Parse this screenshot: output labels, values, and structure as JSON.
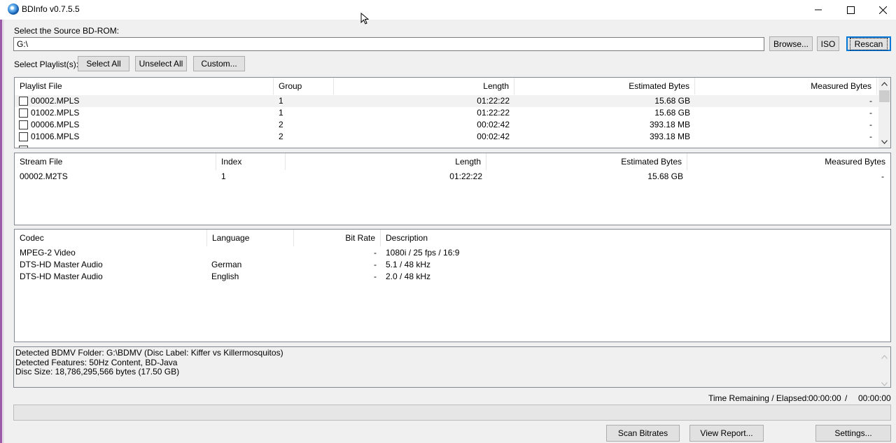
{
  "window": {
    "title": "BDInfo v0.7.5.5",
    "minimize_icon": "minimize-icon",
    "maximize_icon": "maximize-icon",
    "close_icon": "close-icon"
  },
  "source": {
    "label": "Select the Source BD-ROM:",
    "path": "G:\\",
    "browse": "Browse...",
    "iso": "ISO",
    "rescan": "Rescan"
  },
  "playlist_select": {
    "label": "Select Playlist(s):",
    "select_all": "Select All",
    "unselect_all": "Unselect All",
    "custom": "Custom..."
  },
  "playlists": {
    "headers": {
      "file": "Playlist File",
      "group": "Group",
      "length": "Length",
      "est": "Estimated Bytes",
      "meas": "Measured Bytes"
    },
    "rows": [
      {
        "file": "00002.MPLS",
        "group": "1",
        "length": "01:22:22",
        "est": "15.68 GB",
        "meas": "-"
      },
      {
        "file": "01002.MPLS",
        "group": "1",
        "length": "01:22:22",
        "est": "15.68 GB",
        "meas": "-"
      },
      {
        "file": "00006.MPLS",
        "group": "2",
        "length": "00:02:42",
        "est": "393.18 MB",
        "meas": "-"
      },
      {
        "file": "01006.MPLS",
        "group": "2",
        "length": "00:02:42",
        "est": "393.18 MB",
        "meas": "-"
      }
    ]
  },
  "streams": {
    "headers": {
      "file": "Stream File",
      "index": "Index",
      "length": "Length",
      "est": "Estimated Bytes",
      "meas": "Measured Bytes"
    },
    "rows": [
      {
        "file": "00002.M2TS",
        "index": "1",
        "length": "01:22:22",
        "est": "15.68 GB",
        "meas": "-"
      }
    ]
  },
  "codecs": {
    "headers": {
      "codec": "Codec",
      "language": "Language",
      "bitrate": "Bit Rate",
      "desc": "Description"
    },
    "rows": [
      {
        "codec": "MPEG-2 Video",
        "language": "",
        "bitrate": "-",
        "desc": "1080i / 25 fps / 16:9"
      },
      {
        "codec": "DTS-HD Master Audio",
        "language": "German",
        "bitrate": "-",
        "desc": "5.1 / 48 kHz"
      },
      {
        "codec": "DTS-HD Master Audio",
        "language": "English",
        "bitrate": "-",
        "desc": "2.0 / 48 kHz"
      }
    ]
  },
  "status": {
    "lines": [
      "Detected BDMV Folder: G:\\BDMV (Disc Label: Kiffer vs Killermosquitos)",
      "Detected Features: 50Hz Content, BD-Java",
      "Disc Size: 18,786,295,566 bytes (17.50 GB)"
    ]
  },
  "time": {
    "label": "Time Remaining / Elapsed:",
    "remaining": "00:00:00",
    "sep": "/",
    "elapsed": "00:00:00"
  },
  "progress": {
    "value": 0
  },
  "buttons": {
    "scan": "Scan Bitrates",
    "report": "View Report...",
    "settings": "Settings..."
  }
}
